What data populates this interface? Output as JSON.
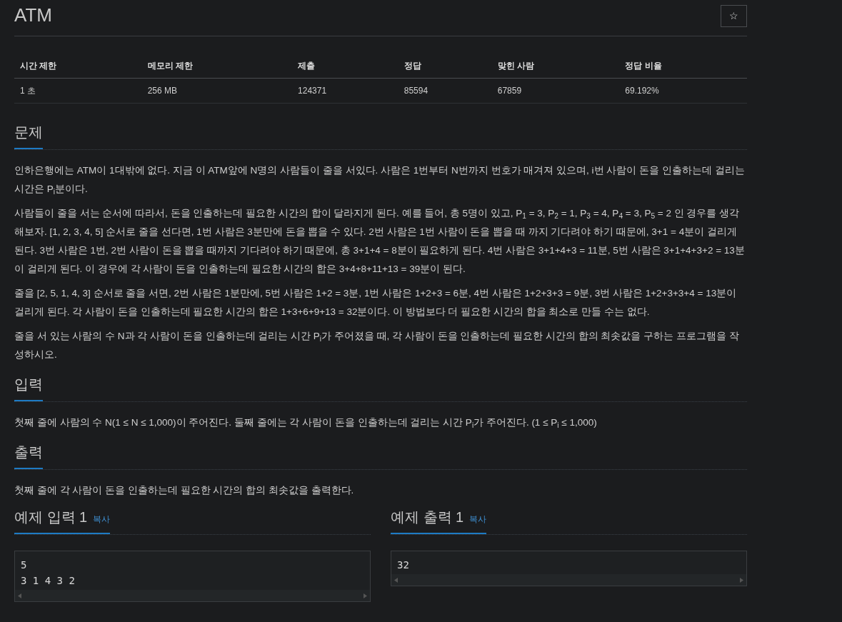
{
  "title": "ATM",
  "star_button": "☆",
  "stats": {
    "columns": [
      "시간 제한",
      "메모리 제한",
      "제출",
      "정답",
      "맞힌 사람",
      "정답 비율"
    ],
    "row": [
      "1 초",
      "256 MB",
      "124371",
      "85594",
      "67859",
      "69.192%"
    ]
  },
  "sections": [
    {
      "heading": "문제",
      "paragraphs": [
        "인하은행에는 ATM이 1대밖에 없다. 지금 이 ATM앞에 N명의 사람들이 줄을 서있다. 사람은 1번부터 N번까지 번호가 매겨져 있으며, i번 사람이 돈을 인출하는데 걸리는 시간은 P$_{i}$분이다.",
        "사람들이 줄을 서는 순서에 따라서, 돈을 인출하는데 필요한 시간의 합이 달라지게 된다. 예를 들어, 총 5명이 있고, P$_{1}$ = 3, P$_{2}$ = 1, P$_{3}$ = 4, P$_{4}$ = 3, P$_{5}$ = 2 인 경우를 생각해보자. [1, 2, 3, 4, 5] 순서로 줄을 선다면, 1번 사람은 3분만에 돈을 뽑을 수 있다. 2번 사람은 1번 사람이 돈을 뽑을 때 까지 기다려야 하기 때문에, 3+1 = 4분이 걸리게 된다. 3번 사람은 1번, 2번 사람이 돈을 뽑을 때까지 기다려야 하기 때문에, 총 3+1+4 = 8분이 필요하게 된다. 4번 사람은 3+1+4+3 = 11분, 5번 사람은 3+1+4+3+2 = 13분이 걸리게 된다. 이 경우에 각 사람이 돈을 인출하는데 필요한 시간의 합은 3+4+8+11+13 = 39분이 된다.",
        "줄을 [2, 5, 1, 4, 3] 순서로 줄을 서면, 2번 사람은 1분만에, 5번 사람은 1+2 = 3분, 1번 사람은 1+2+3 = 6분, 4번 사람은 1+2+3+3 = 9분, 3번 사람은 1+2+3+3+4 = 13분이 걸리게 된다. 각 사람이 돈을 인출하는데 필요한 시간의 합은 1+3+6+9+13 = 32분이다. 이 방법보다 더 필요한 시간의 합을 최소로 만들 수는 없다.",
        "줄을 서 있는 사람의 수 N과 각 사람이 돈을 인출하는데 걸리는 시간 P$_{i}$가 주어졌을 때, 각 사람이 돈을 인출하는데 필요한 시간의 합의 최솟값을 구하는 프로그램을 작성하시오."
      ]
    },
    {
      "heading": "입력",
      "paragraphs": [
        "첫째 줄에 사람의 수 N(1 ≤ N ≤ 1,000)이 주어진다. 둘째 줄에는 각 사람이 돈을 인출하는데 걸리는 시간 P$_{i}$가 주어진다. (1 ≤ P$_{i}$ ≤ 1,000)"
      ]
    },
    {
      "heading": "출력",
      "paragraphs": [
        "첫째 줄에 각 사람이 돈을 인출하는데 필요한 시간의 합의 최솟값을 출력한다."
      ]
    }
  ],
  "samples": [
    {
      "heading": "예제 입력 1",
      "copy": "복사",
      "lines": [
        "5",
        "3 1 4 3 2"
      ]
    },
    {
      "heading": "예제 출력 1",
      "copy": "복사",
      "lines": [
        "32"
      ]
    }
  ]
}
